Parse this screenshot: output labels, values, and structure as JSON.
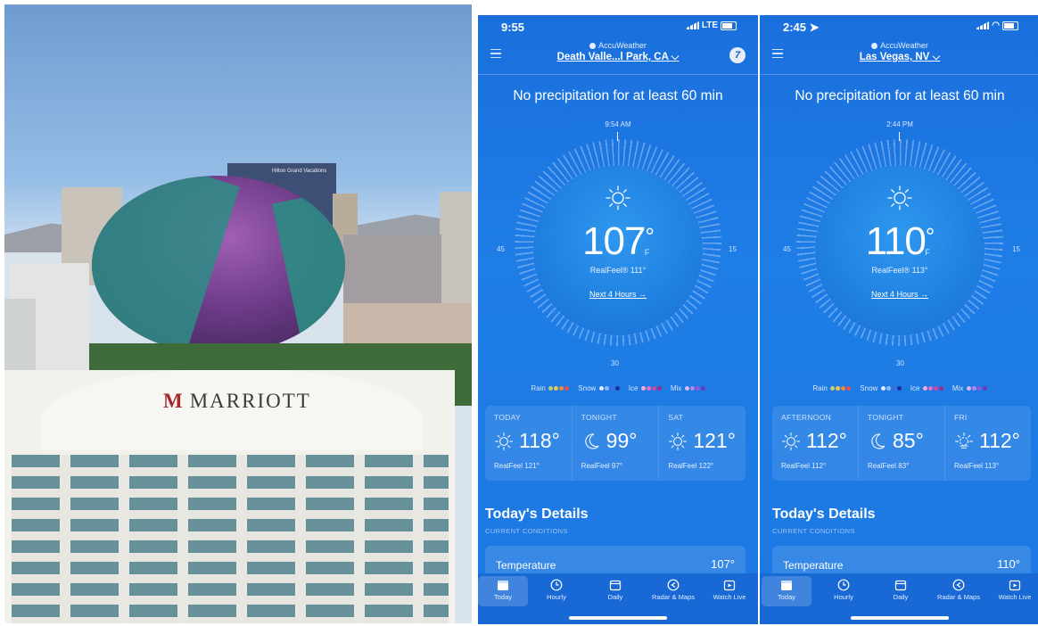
{
  "photo": {
    "sign_text": "Hilton Grand Vacations",
    "hotel_name": "MARRIOTT",
    "hotel_logo_letter": "M"
  },
  "phones": [
    {
      "status": {
        "time": "9:55",
        "network": "LTE"
      },
      "brand": "AccuWeather",
      "location": "Death Valle...l Park, CA ⌵",
      "channel_logo": "7",
      "precip_text": "No precipitation for at least 60 min",
      "dial": {
        "time": "9:54 AM",
        "left_label": "45",
        "right_label": "15",
        "bottom_label": "30"
      },
      "current": {
        "temp": "107",
        "unit": "F",
        "realfeel": "RealFeel® 111°",
        "next_hours": "Next 4 Hours →"
      },
      "legend": {
        "rain": "Rain",
        "snow": "Snow",
        "ice": "Ice",
        "mix": "Mix"
      },
      "forecast": [
        {
          "label": "TODAY",
          "icon": "sun-icon",
          "temp": "118°",
          "realfeel": "RealFeel 121°"
        },
        {
          "label": "TONIGHT",
          "icon": "moon-icon",
          "temp": "99°",
          "realfeel": "RealFeel 97°"
        },
        {
          "label": "SAT",
          "icon": "sun-icon",
          "temp": "121°",
          "realfeel": "RealFeel 122°"
        }
      ],
      "details": {
        "title": "Today's Details",
        "subtitle": "CURRENT CONDITIONS",
        "label": "Temperature",
        "value": "107°"
      },
      "tabs": [
        "Today",
        "Hourly",
        "Daily",
        "Radar & Maps",
        "Watch Live"
      ]
    },
    {
      "status": {
        "time": "2:45 ➤",
        "network": ""
      },
      "brand": "AccuWeather",
      "location": "Las Vegas, NV ⌵",
      "channel_logo": "",
      "precip_text": "No precipitation for at least 60 min",
      "dial": {
        "time": "2:44 PM",
        "left_label": "45",
        "right_label": "15",
        "bottom_label": "30"
      },
      "current": {
        "temp": "110",
        "unit": "F",
        "realfeel": "RealFeel® 113°",
        "next_hours": "Next 4 Hours →"
      },
      "legend": {
        "rain": "Rain",
        "snow": "Snow",
        "ice": "Ice",
        "mix": "Mix"
      },
      "forecast": [
        {
          "label": "AFTERNOON",
          "icon": "sun-icon",
          "temp": "112°",
          "realfeel": "RealFeel 112°"
        },
        {
          "label": "TONIGHT",
          "icon": "moon-icon",
          "temp": "85°",
          "realfeel": "RealFeel 83°"
        },
        {
          "label": "FRI",
          "icon": "hazy-sun-icon",
          "temp": "112°",
          "realfeel": "RealFeel 113°"
        }
      ],
      "details": {
        "title": "Today's Details",
        "subtitle": "CURRENT CONDITIONS",
        "label": "Temperature",
        "value": "110°"
      },
      "tabs": [
        "Today",
        "Hourly",
        "Daily",
        "Radar & Maps",
        "Watch Live"
      ]
    }
  ],
  "colors": {
    "background": "#1c78e2",
    "tabbar": "#1869d6",
    "rain_dots": [
      "#b9d26a",
      "#f1c64b",
      "#f08a3f",
      "#e84f4f"
    ],
    "snow_dots": [
      "#dfe9ff",
      "#8db8ff",
      "#3e6fe0",
      "#1c2f9b"
    ],
    "ice_dots": [
      "#f6a8d8",
      "#e56fc1",
      "#c94aa9",
      "#9d2c8d"
    ],
    "mix_dots": [
      "#d9b6f5",
      "#b383ea",
      "#8f58d8",
      "#6b3bbd"
    ]
  }
}
